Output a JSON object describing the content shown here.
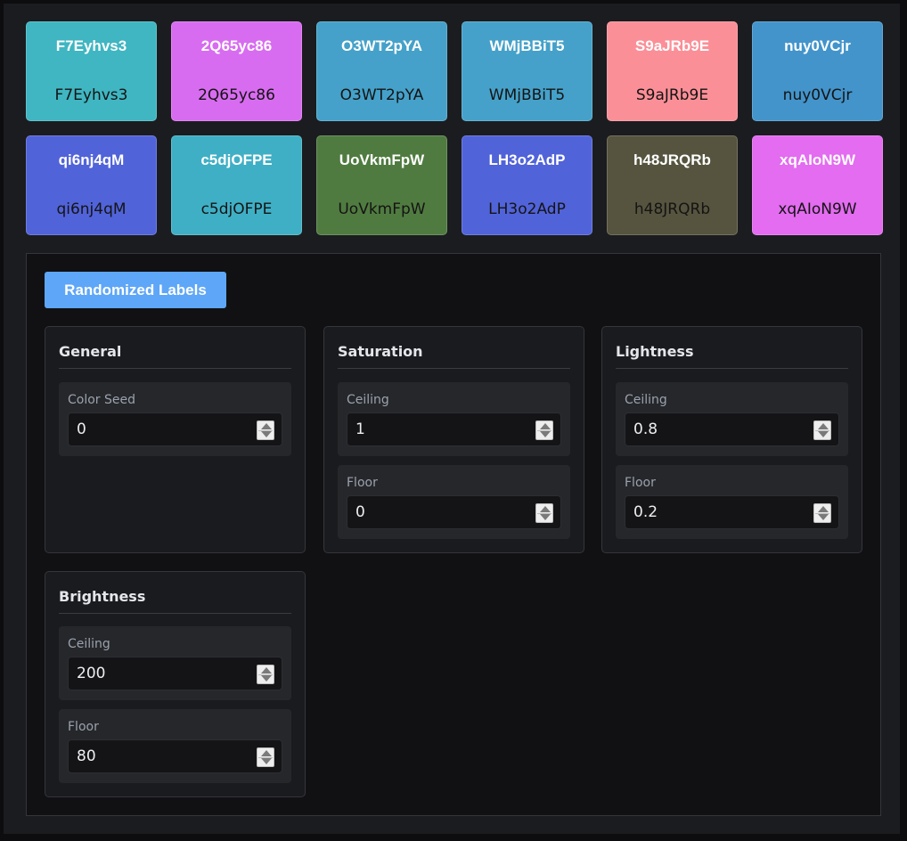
{
  "swatches": [
    {
      "top": "F7Eyhvs3",
      "bottom": "F7Eyhvs3",
      "bg": "#3fb6c2",
      "fg": "#141414"
    },
    {
      "top": "2Q65yc86",
      "bottom": "2Q65yc86",
      "bg": "#d86cf0",
      "fg": "#141414"
    },
    {
      "top": "O3WT2pYA",
      "bottom": "O3WT2pYA",
      "bg": "#45a1c9",
      "fg": "#141414"
    },
    {
      "top": "WMjBBiT5",
      "bottom": "WMjBBiT5",
      "bg": "#45a1c9",
      "fg": "#141414"
    },
    {
      "top": "S9aJRb9E",
      "bottom": "S9aJRb9E",
      "bg": "#fb8f97",
      "fg": "#141414"
    },
    {
      "top": "nuy0VCjr",
      "bottom": "nuy0VCjr",
      "bg": "#4394cb",
      "fg": "#141414"
    },
    {
      "top": "qi6nj4qM",
      "bottom": "qi6nj4qM",
      "bg": "#5163d9",
      "fg": "#141414"
    },
    {
      "top": "c5djOFPE",
      "bottom": "c5djOFPE",
      "bg": "#3fafc5",
      "fg": "#141414"
    },
    {
      "top": "UoVkmFpW",
      "bottom": "UoVkmFpW",
      "bg": "#507b40",
      "fg": "#141414"
    },
    {
      "top": "LH3o2AdP",
      "bottom": "LH3o2AdP",
      "bg": "#5163d9",
      "fg": "#141414"
    },
    {
      "top": "h48JRQRb",
      "bottom": "h48JRQRb",
      "bg": "#56543e",
      "fg": "#141414"
    },
    {
      "top": "xqAIoN9W",
      "bottom": "xqAIoN9W",
      "bg": "#e36cf0",
      "fg": "#141414"
    }
  ],
  "button": {
    "label": "Randomized Labels"
  },
  "groups": {
    "general": {
      "title": "General",
      "fields": [
        {
          "label": "Color Seed",
          "value": "0"
        }
      ]
    },
    "saturation": {
      "title": "Saturation",
      "fields": [
        {
          "label": "Ceiling",
          "value": "1"
        },
        {
          "label": "Floor",
          "value": "0"
        }
      ]
    },
    "lightness": {
      "title": "Lightness",
      "fields": [
        {
          "label": "Ceiling",
          "value": "0.8"
        },
        {
          "label": "Floor",
          "value": "0.2"
        }
      ]
    },
    "brightness": {
      "title": "Brightness",
      "fields": [
        {
          "label": "Ceiling",
          "value": "200"
        },
        {
          "label": "Floor",
          "value": "80"
        }
      ]
    }
  },
  "icons": {
    "spinner": "spinner-arrows-icon"
  }
}
